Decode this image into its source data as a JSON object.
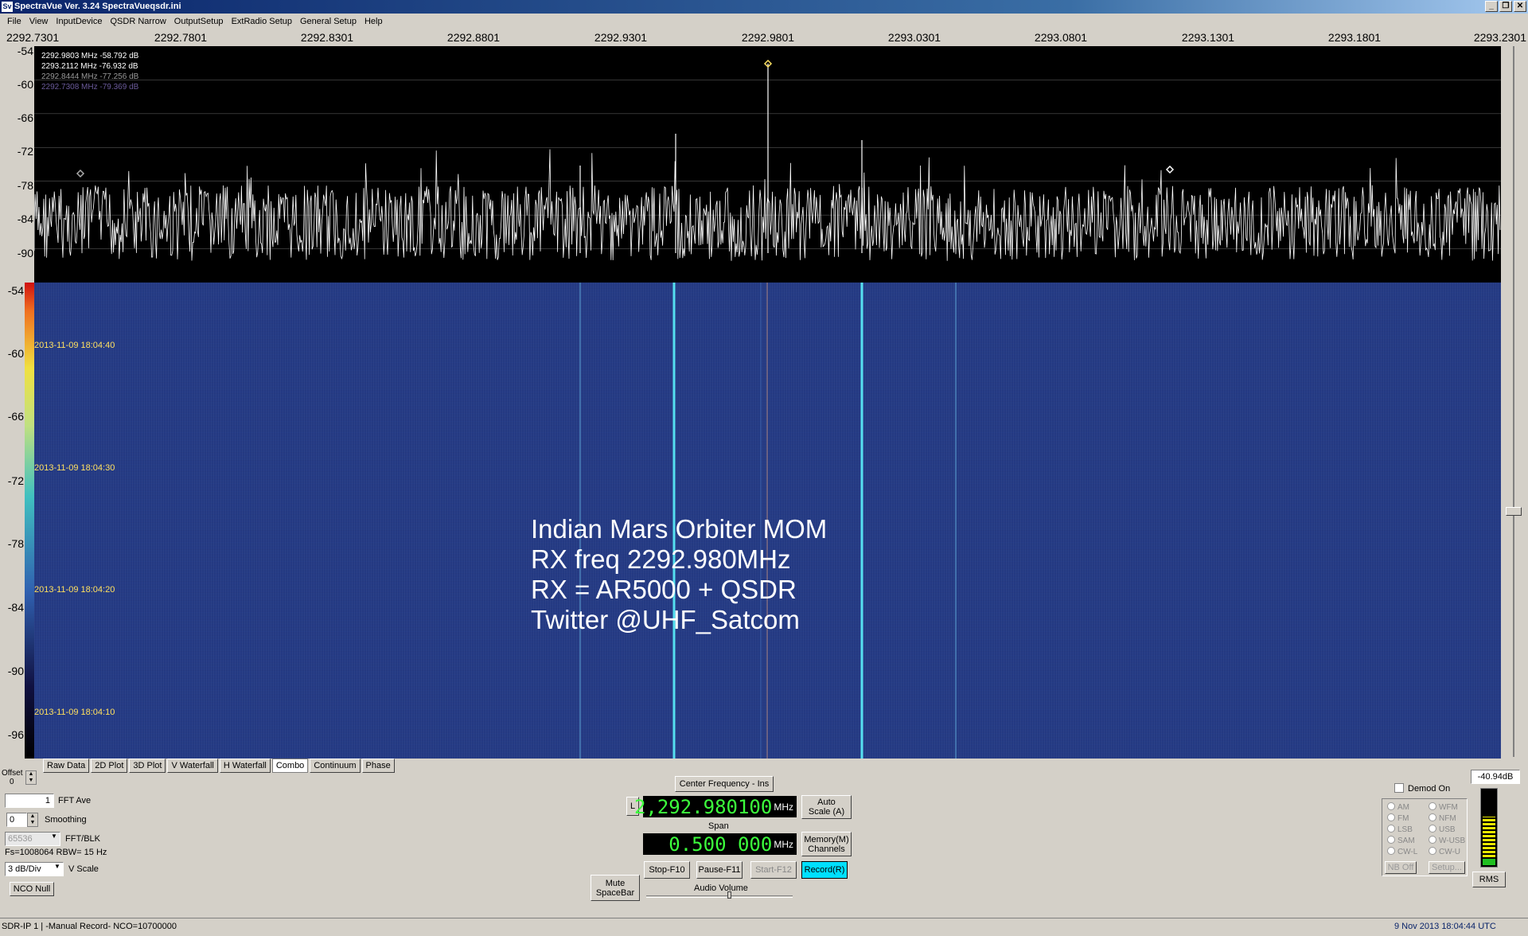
{
  "window": {
    "icon_text": "Sv",
    "title": "SpectraVue Ver. 3.24  SpectraVueqsdr.ini",
    "minimize": "_",
    "restore": "❐",
    "close": "✕"
  },
  "menu": [
    "File",
    "View",
    "InputDevice",
    "QSDR Narrow",
    "OutputSetup",
    "ExtRadio Setup",
    "General Setup",
    "Help"
  ],
  "freq_axis": [
    "2292.7301",
    "2292.7801",
    "2292.8301",
    "2292.8801",
    "2292.9301",
    "2292.9801",
    "2293.0301",
    "2293.0801",
    "2293.1301",
    "2293.1801",
    "2293.2301"
  ],
  "spectrum": {
    "db_ticks": [
      "-54",
      "-60",
      "-66",
      "-72",
      "-78",
      "-84",
      "-90"
    ],
    "markers": [
      {
        "text": "2292.9803 MHz -58.792 dB",
        "color": "#ffffff"
      },
      {
        "text": "2293.2112 MHz -76.932 dB",
        "color": "#ffffff"
      },
      {
        "text": "2292.8444 MHz -77.256 dB",
        "color": "#9a9a9a"
      },
      {
        "text": "2292.7308 MHz -79.369 dB",
        "color": "#6a5a9a"
      }
    ],
    "ylim": [
      -96,
      -54
    ]
  },
  "waterfall": {
    "db_ticks": [
      "-54",
      "-60",
      "-66",
      "-72",
      "-78",
      "-84",
      "-90",
      "-96"
    ],
    "timestamps": [
      "2013-11-09 18:04:40",
      "2013-11-09 18:04:30",
      "2013-11-09 18:04:20",
      "2013-11-09 18:04:10"
    ],
    "overlay": [
      "Indian Mars Orbiter MOM",
      "RX freq 2292.980MHz",
      "RX = AR5000 + QSDR",
      "Twitter @UHF_Satcom"
    ]
  },
  "tabs": [
    "Raw Data",
    "2D Plot",
    "3D Plot",
    "V Waterfall",
    "H Waterfall",
    "Combo",
    "Continuum",
    "Phase"
  ],
  "active_tab": "Combo",
  "left_controls": {
    "offset_label": "Offset",
    "offset_value": "0",
    "fft_ave_value": "1",
    "fft_ave_label": "FFT Ave",
    "smoothing_value": "0",
    "smoothing_label": "Smoothing",
    "fft_blk_value": "65536",
    "fft_blk_label": "FFT/BLK",
    "fs_text": "Fs=1008064 RBW= 15 Hz",
    "vscale_value": "3 dB/Div",
    "vscale_label": "V Scale",
    "nco_null": "NCO Null"
  },
  "center": {
    "center_freq_button": "Center Frequency - Ins",
    "lock_button": "L",
    "center_freq_value": "2,292.980100",
    "center_freq_unit": "MHz",
    "auto_scale": "Auto Scale (A)",
    "span_label": "Span",
    "span_value": "0.500 000",
    "span_unit": "MHz",
    "memory_channels": "Memory(M) Channels",
    "stop": "Stop-F10",
    "pause": "Pause-F11",
    "start": "Start-F12",
    "record": "Record(R)",
    "mute": "Mute SpaceBar",
    "audio_volume": "Audio Volume"
  },
  "right_controls": {
    "level": "-40.94dB",
    "demod_on": "Demod On",
    "modes_left": [
      "AM",
      "FM",
      "LSB",
      "SAM",
      "CW-L"
    ],
    "modes_right": [
      "WFM",
      "NFM",
      "USB",
      "W-USB",
      "CW-U"
    ],
    "nb_off": "NB Off",
    "setup": "Setup...",
    "rms": "RMS"
  },
  "status": {
    "left": "SDR-IP 1  | -Manual Record-   NCO=10700000",
    "right": "9 Nov 2013  18:04:44 UTC"
  },
  "colors": {
    "record_active": "#00e0ff",
    "lcd_text": "#3cff3c",
    "timestamp": "#ffe060"
  }
}
